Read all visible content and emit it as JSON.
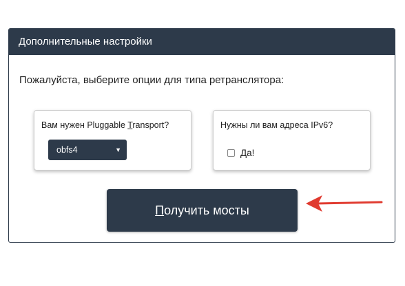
{
  "panel": {
    "title": "Дополнительные настройки",
    "intro": "Пожалуйста, выберите опции для типа ретранслятора:"
  },
  "transport": {
    "label_prefix": "Вам нужен Pluggable ",
    "label_accel": "T",
    "label_suffix": "ransport?",
    "selected": "obfs4"
  },
  "ipv6": {
    "label": "Нужны ли вам адреса IPv6?",
    "checkbox_accel": "Д",
    "checkbox_rest": "а!",
    "checked": false
  },
  "button": {
    "accel": "П",
    "rest": "олучить мосты"
  },
  "colors": {
    "primary": "#2d3a4a",
    "arrow": "#e03a2f"
  },
  "icons": {
    "dropdown": "caret-down-icon",
    "annotation": "red-arrow-icon"
  }
}
